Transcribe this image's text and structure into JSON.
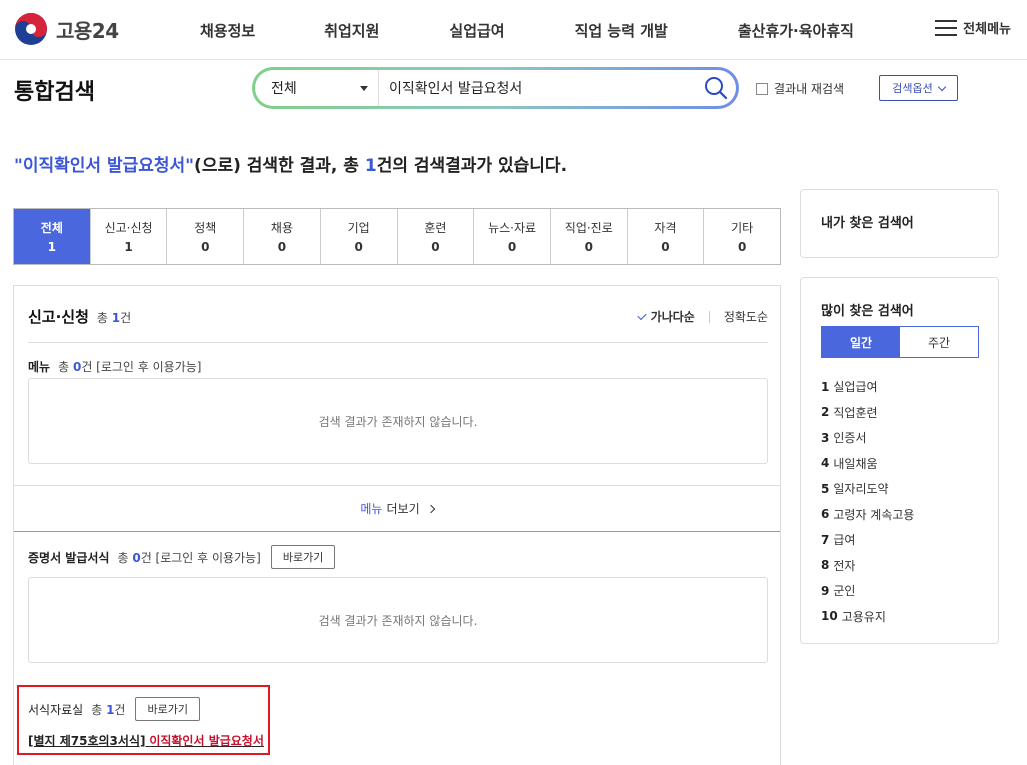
{
  "header": {
    "logo_text": "고용24",
    "nav": [
      "채용정보",
      "취업지원",
      "실업급여",
      "직업 능력 개발",
      "출산휴가·육아휴직"
    ],
    "all_menu_label": "전체메뉴"
  },
  "search": {
    "page_title": "통합검색",
    "scope": "전체",
    "query": "이직확인서 발급요청서",
    "re_search_label": "결과내 재검색",
    "options_label": "검색옵션"
  },
  "summary": {
    "keyword": "\"이직확인서 발급요청서\"",
    "pre": "(으로) 검색한 결과, 총 ",
    "count": "1",
    "post": "건의 검색결과가 있습니다."
  },
  "tabs": [
    {
      "label": "전체",
      "count": "1"
    },
    {
      "label": "신고·신청",
      "count": "1"
    },
    {
      "label": "정책",
      "count": "0"
    },
    {
      "label": "채용",
      "count": "0"
    },
    {
      "label": "기업",
      "count": "0"
    },
    {
      "label": "훈련",
      "count": "0"
    },
    {
      "label": "뉴스·자료",
      "count": "0"
    },
    {
      "label": "직업·진로",
      "count": "0"
    },
    {
      "label": "자격",
      "count": "0"
    },
    {
      "label": "기타",
      "count": "0"
    }
  ],
  "results": {
    "section_title": "신고·신청",
    "section_total_prefix": "총 ",
    "section_total": "1",
    "section_total_suffix": "건",
    "sort_active": "가나다순",
    "sort_other": "정확도순",
    "menu": {
      "title": "메뉴",
      "total_prefix": "총 ",
      "total": "0",
      "total_suffix": "건 [로그인 후 이용가능]",
      "empty": "검색 결과가 존재하지 않습니다.",
      "more_label_a": "메뉴",
      "more_label_b": " 더보기"
    },
    "cert": {
      "title": "증명서 발급서식",
      "total_prefix": "총 ",
      "total": "0",
      "total_suffix": "건 [로그인 후 이용가능]",
      "goto": "바로가기",
      "empty": "검색 결과가 존재하지 않습니다."
    },
    "forms": {
      "title": "서식자료실",
      "total_prefix": "총 ",
      "total": "1",
      "total_suffix": "건",
      "goto": "바로가기",
      "item_prefix": "[별지 제75호의3서식]",
      "item_title": "이직확인서 발급요청서"
    }
  },
  "sidebar": {
    "my_searches_title": "내가 찾은 검색어",
    "popular_title": "많이 찾은 검색어",
    "period_tabs": [
      "일간",
      "주간"
    ],
    "popular": [
      {
        "rank": "1",
        "term": "실업급여"
      },
      {
        "rank": "2",
        "term": "직업훈련"
      },
      {
        "rank": "3",
        "term": "인증서"
      },
      {
        "rank": "4",
        "term": "내일채움"
      },
      {
        "rank": "5",
        "term": "일자리도약"
      },
      {
        "rank": "6",
        "term": "고령자 계속고용"
      },
      {
        "rank": "7",
        "term": "급여"
      },
      {
        "rank": "8",
        "term": "전자"
      },
      {
        "rank": "9",
        "term": "군인"
      },
      {
        "rank": "10",
        "term": "고용유지"
      }
    ]
  },
  "colors": {
    "accent": "#4a67de",
    "keyword": "#3b57d6",
    "highlight_border": "#e0191f",
    "link_red": "#c8102e"
  }
}
